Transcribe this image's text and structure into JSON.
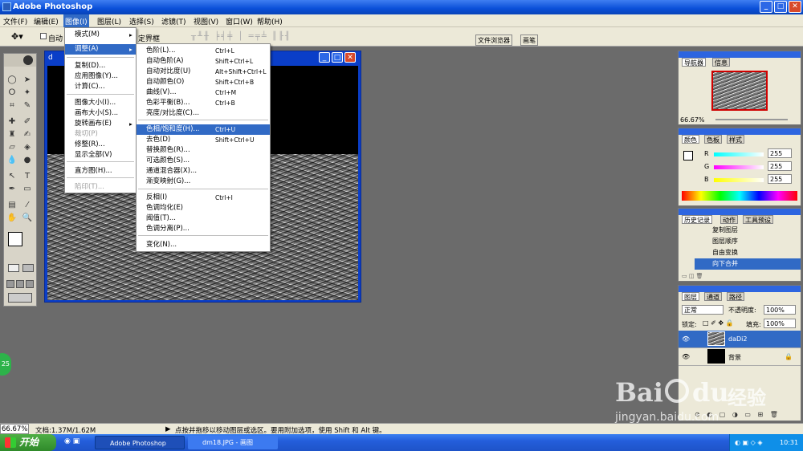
{
  "app": {
    "title": "Adobe Photoshop"
  },
  "menubar": [
    "文件(F)",
    "编辑(E)",
    "图像(I)",
    "图层(L)",
    "选择(S)",
    "滤镜(T)",
    "视图(V)",
    "窗口(W)",
    "帮助(H)"
  ],
  "options": {
    "auto_select": "自动",
    "bbox_label": "定界框",
    "tabs": [
      "文件浏览器",
      "画笔"
    ]
  },
  "image_menu": {
    "items": [
      {
        "label": "模式(M)",
        "sub": true
      },
      {
        "label": "调整(A)",
        "sub": true,
        "highlight": true
      },
      {
        "label": "复制(D)..."
      },
      {
        "label": "应用图像(Y)..."
      },
      {
        "label": "计算(C)..."
      },
      {
        "label": "图像大小(I)..."
      },
      {
        "label": "画布大小(S)..."
      },
      {
        "label": "旋转画布(E)",
        "sub": true
      },
      {
        "label": "裁切(P)",
        "disabled": true
      },
      {
        "label": "修整(R)..."
      },
      {
        "label": "显示全部(V)"
      },
      {
        "label": "直方图(H)..."
      },
      {
        "label": "陷印(T)...",
        "disabled": true
      }
    ]
  },
  "adjust_menu": {
    "items": [
      {
        "label": "色阶(L)...",
        "shortcut": "Ctrl+L"
      },
      {
        "label": "自动色阶(A)",
        "shortcut": "Shift+Ctrl+L"
      },
      {
        "label": "自动对比度(U)",
        "shortcut": "Alt+Shift+Ctrl+L"
      },
      {
        "label": "自动颜色(O)",
        "shortcut": "Shift+Ctrl+B"
      },
      {
        "label": "曲线(V)...",
        "shortcut": "Ctrl+M"
      },
      {
        "label": "色彩平衡(B)...",
        "shortcut": "Ctrl+B"
      },
      {
        "label": "亮度/对比度(C)...",
        "shortcut": ""
      },
      {
        "label": "色相/饱和度(H)...",
        "shortcut": "Ctrl+U",
        "highlight": true
      },
      {
        "label": "去色(D)",
        "shortcut": "Shift+Ctrl+U"
      },
      {
        "label": "替换颜色(R)...",
        "shortcut": ""
      },
      {
        "label": "可选颜色(S)...",
        "shortcut": ""
      },
      {
        "label": "通道混合器(X)...",
        "shortcut": ""
      },
      {
        "label": "渐变映射(G)...",
        "shortcut": ""
      },
      {
        "label": "反相(I)",
        "shortcut": "Ctrl+I"
      },
      {
        "label": "色调均化(E)",
        "shortcut": ""
      },
      {
        "label": "阈值(T)...",
        "shortcut": ""
      },
      {
        "label": "色调分离(P)...",
        "shortcut": ""
      },
      {
        "label": "变化(N)...",
        "shortcut": ""
      }
    ]
  },
  "navigator": {
    "tabs": [
      "导航器",
      "信息"
    ],
    "zoom": "66.67%"
  },
  "color": {
    "tabs": [
      "颜色",
      "色板",
      "样式"
    ],
    "channels": [
      {
        "name": "R",
        "value": "255"
      },
      {
        "name": "G",
        "value": "255"
      },
      {
        "name": "B",
        "value": "255"
      }
    ]
  },
  "history": {
    "tabs": [
      "历史记录",
      "动作",
      "工具预设"
    ],
    "items": [
      "复制图层",
      "图层顺序",
      "自由变换",
      "向下合并"
    ]
  },
  "layers": {
    "tabs": [
      "图层",
      "通道",
      "路径"
    ],
    "blend_mode": "正常",
    "opacity_label": "不透明度:",
    "opacity": "100%",
    "lock_label": "锁定:",
    "fill_label": "填充:",
    "fill": "100%",
    "items": [
      "daDi2",
      "背景"
    ]
  },
  "status": {
    "zoom": "66.67%",
    "doc": "文档:1.37M/1.62M",
    "hint": "点按并拖移以移动图层或选区。要用附加选项，使用 Shift 和 Alt 键。"
  },
  "taskbar": {
    "start": "开始",
    "tasks": [
      "Adobe Photoshop",
      "dm18.JPG - 画图"
    ],
    "time": "10:31"
  },
  "green_badge": "25",
  "watermark": {
    "brand": "Bai",
    "brand2": "du",
    "cn": "经验",
    "url": "jingyan.baidu.com"
  },
  "colors": {
    "titlebar": "#0a4fd8",
    "highlight": "#316ac5",
    "workspace": "#6b6b6b"
  }
}
